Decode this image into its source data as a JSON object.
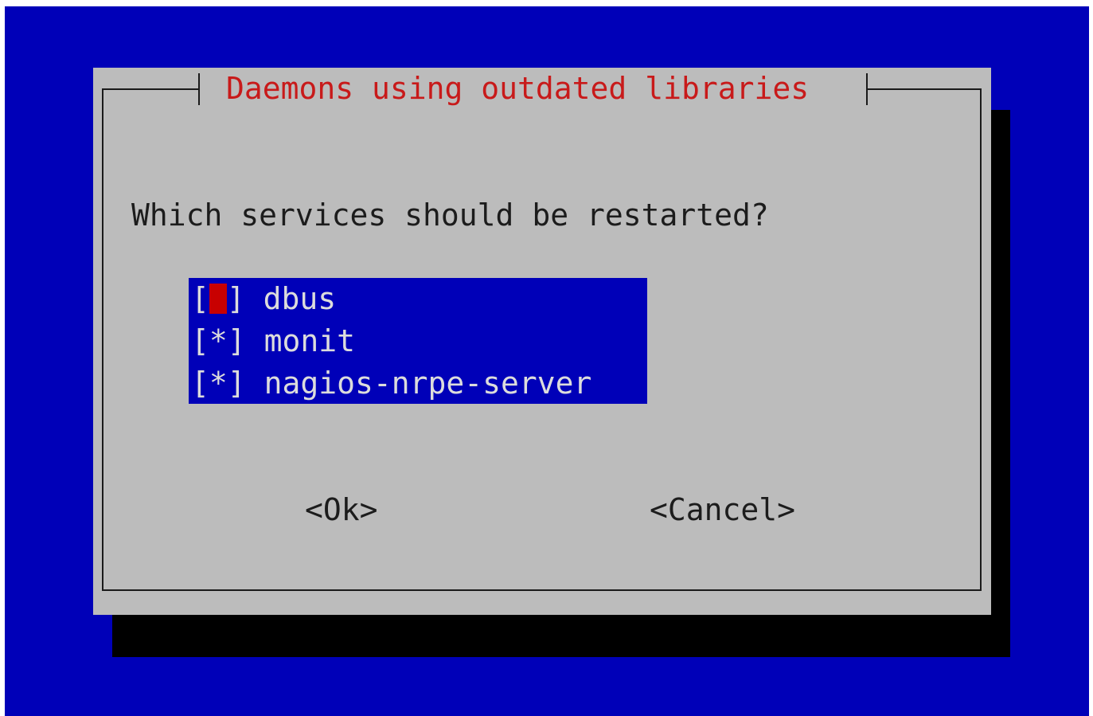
{
  "dialog": {
    "title": "Daemons using outdated libraries",
    "question": "Which services should be restarted?"
  },
  "services": [
    {
      "name": "dbus",
      "checked": false,
      "focused": true
    },
    {
      "name": "monit",
      "checked": true,
      "focused": false
    },
    {
      "name": "nagios-nrpe-server",
      "checked": true,
      "focused": false
    }
  ],
  "check_marks": {
    "open": "[",
    "close": "]",
    "checked": "*",
    "unchecked": " "
  },
  "buttons": {
    "ok": "<Ok>",
    "cancel": "<Cancel>"
  },
  "colors": {
    "background": "#0000b8",
    "dialog": "#bcbcbc",
    "title": "#c81a1a",
    "list_bg": "#0000b8",
    "list_text": "#dcdcdc",
    "cursor": "#c80000",
    "shadow": "#000000"
  }
}
